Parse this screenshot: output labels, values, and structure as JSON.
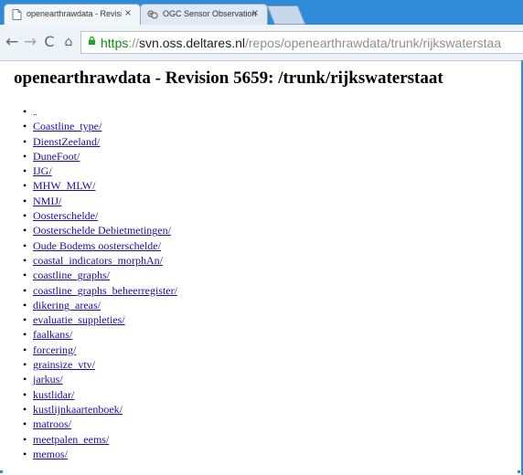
{
  "browser": {
    "tabs": [
      {
        "label": "openearthrawdata - Revisior",
        "close": "×",
        "active": true,
        "icon": "document-icon"
      },
      {
        "label": "OGC Sensor Observation Ser",
        "close": "×",
        "active": false,
        "icon": "sensor-icon"
      }
    ],
    "toolbar": {
      "back": "←",
      "forward": "→",
      "reload": "C",
      "home": "⌂"
    },
    "address": {
      "scheme": "https",
      "separator": "://",
      "host": "svn.oss.deltares.nl",
      "path": "/repos/openearthrawdata/trunk/rijkswaterstaa"
    }
  },
  "page": {
    "heading": "openearthrawdata - Revision 5659: /trunk/rijkswaterstaat",
    "entries": [
      "..",
      "Coastline_type/",
      "DienstZeeland/",
      "DuneFoot/",
      "IJG/",
      "MHW_MLW/",
      "NMIJ/",
      "Oosterschelde/",
      "Oosterschelde Debietmetingen/",
      "Oude Bodems oosterschelde/",
      "coastal_indicators_morphAn/",
      "coastline_graphs/",
      "coastline_graphs_beheerregister/",
      "dikering_areas/",
      "evaluatie_suppleties/",
      "faalkans/",
      "forcering/",
      "grainsize_vtv/",
      "jarkus/",
      "kustlidar/",
      "kustlijnkaartenboek/",
      "matroos/",
      "meetpalen_eems/",
      "memos/"
    ]
  },
  "colors": {
    "tabstrip": "#2f8ad8",
    "link": "#1a0dab",
    "secure": "#0b8d12"
  }
}
